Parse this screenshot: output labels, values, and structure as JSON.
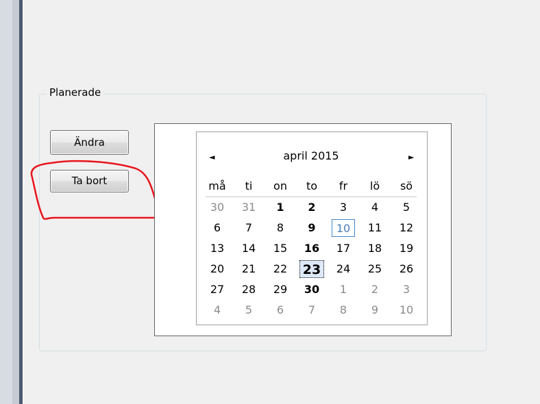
{
  "groupbox": {
    "title": "Planerade"
  },
  "buttons": {
    "edit_label": "Ändra",
    "delete_label": "Ta bort"
  },
  "annotation": {
    "color": "#e8141c"
  },
  "calendar": {
    "month_label": "april 2015",
    "prev_glyph": "◄",
    "next_glyph": "►",
    "weekdays": [
      "må",
      "ti",
      "on",
      "to",
      "fr",
      "lö",
      "sö"
    ],
    "today": 10,
    "selected": 23,
    "weeks": [
      [
        {
          "d": "30",
          "o": true
        },
        {
          "d": "31",
          "o": true
        },
        {
          "d": "1",
          "b": true
        },
        {
          "d": "2",
          "b": true
        },
        {
          "d": "3"
        },
        {
          "d": "4"
        },
        {
          "d": "5"
        }
      ],
      [
        {
          "d": "6"
        },
        {
          "d": "7"
        },
        {
          "d": "8"
        },
        {
          "d": "9",
          "b": true
        },
        {
          "d": "10",
          "t": true
        },
        {
          "d": "11"
        },
        {
          "d": "12"
        }
      ],
      [
        {
          "d": "13"
        },
        {
          "d": "14"
        },
        {
          "d": "15"
        },
        {
          "d": "16",
          "b": true
        },
        {
          "d": "17"
        },
        {
          "d": "18"
        },
        {
          "d": "19"
        }
      ],
      [
        {
          "d": "20"
        },
        {
          "d": "21"
        },
        {
          "d": "22"
        },
        {
          "d": "23",
          "s": true
        },
        {
          "d": "24"
        },
        {
          "d": "25"
        },
        {
          "d": "26"
        }
      ],
      [
        {
          "d": "27"
        },
        {
          "d": "28"
        },
        {
          "d": "29"
        },
        {
          "d": "30",
          "b": true
        },
        {
          "d": "1",
          "o": true
        },
        {
          "d": "2",
          "o": true
        },
        {
          "d": "3",
          "o": true
        }
      ],
      [
        {
          "d": "4",
          "o": true
        },
        {
          "d": "5",
          "o": true
        },
        {
          "d": "6",
          "o": true
        },
        {
          "d": "7",
          "o": true
        },
        {
          "d": "8",
          "o": true
        },
        {
          "d": "9",
          "o": true
        },
        {
          "d": "10",
          "o": true
        }
      ]
    ]
  }
}
